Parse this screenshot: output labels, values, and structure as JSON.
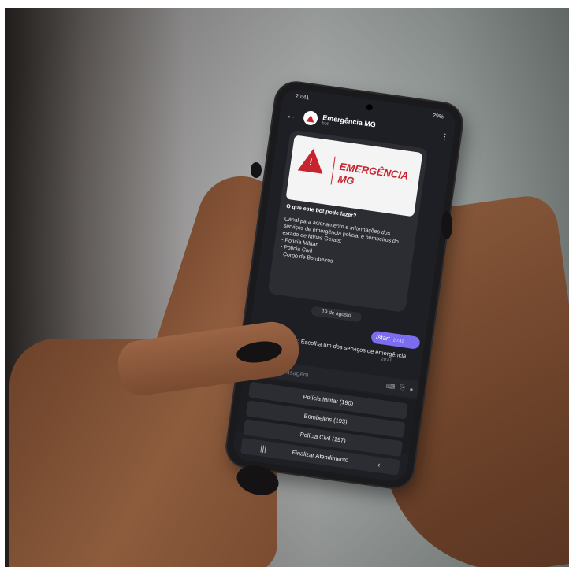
{
  "status_bar": {
    "time": "20:41",
    "battery": "29%"
  },
  "app_bar": {
    "title": "Emergência MG",
    "subtitle": "bot"
  },
  "bot_info": {
    "brand_line1": "EMERGÊNCIA",
    "brand_line2": "MG",
    "question": "O que este bot pode fazer?",
    "description": "Canal para acionamento e informações dos serviços de emergência policial e bombeiros do estado de Minas Gerais:\n- Polícia Militar\n- Polícia Civil\n- Corpo de Bombeiros"
  },
  "date_separator": "19 de agosto",
  "outgoing_message": {
    "text": "/start",
    "time": "20:41"
  },
  "incoming_message": {
    "text": "Emergência MG: Escolha um dos serviços de emergência",
    "time": "20:41"
  },
  "input": {
    "placeholder": "Mensagem"
  },
  "keyboard_buttons": [
    "Polícia Militar (190)",
    "Bombeiros (193)",
    "Polícia Civil (197)",
    "Finalizar Atendimento"
  ],
  "colors": {
    "brand_red": "#c7232d",
    "accent_purple": "#7b6cf0",
    "menu_blue": "#5b8def"
  },
  "icons": [
    "back-arrow-icon",
    "more-vertical-icon",
    "menu-icon",
    "emoji-icon",
    "keyboard-icon",
    "attach-icon",
    "microphone-icon"
  ]
}
